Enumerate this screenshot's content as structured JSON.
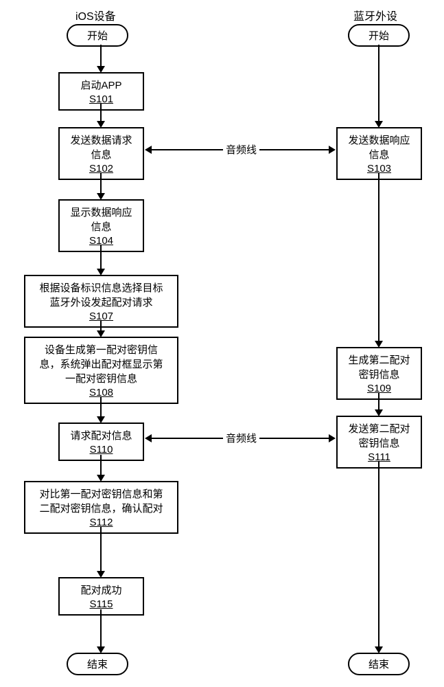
{
  "headers": {
    "left": "iOS设备",
    "right": "蓝牙外设"
  },
  "terminals": {
    "start": "开始",
    "end": "结束"
  },
  "steps": {
    "s101": {
      "text": "启动APP",
      "id": "S101"
    },
    "s102": {
      "text": "发送数据请求\n信息",
      "id": "S102"
    },
    "s103": {
      "text": "发送数据响应\n信息",
      "id": "S103"
    },
    "s104": {
      "text": "显示数据响应\n信息",
      "id": "S104"
    },
    "s107": {
      "text": "根据设备标识信息选择目标\n蓝牙外设发起配对请求",
      "id": "S107"
    },
    "s108": {
      "text": "设备生成第一配对密钥信\n息，系统弹出配对框显示第\n一配对密钥信息",
      "id": "S108"
    },
    "s109": {
      "text": "生成第二配对\n密钥信息",
      "id": "S109"
    },
    "s110": {
      "text": "请求配对信息",
      "id": "S110"
    },
    "s111": {
      "text": "发送第二配对\n密钥信息",
      "id": "S111"
    },
    "s112": {
      "text": "对比第一配对密钥信息和第\n二配对密钥信息，确认配对",
      "id": "S112"
    },
    "s115": {
      "text": "配对成功",
      "id": "S115"
    }
  },
  "edges": {
    "audio": "音频线"
  }
}
